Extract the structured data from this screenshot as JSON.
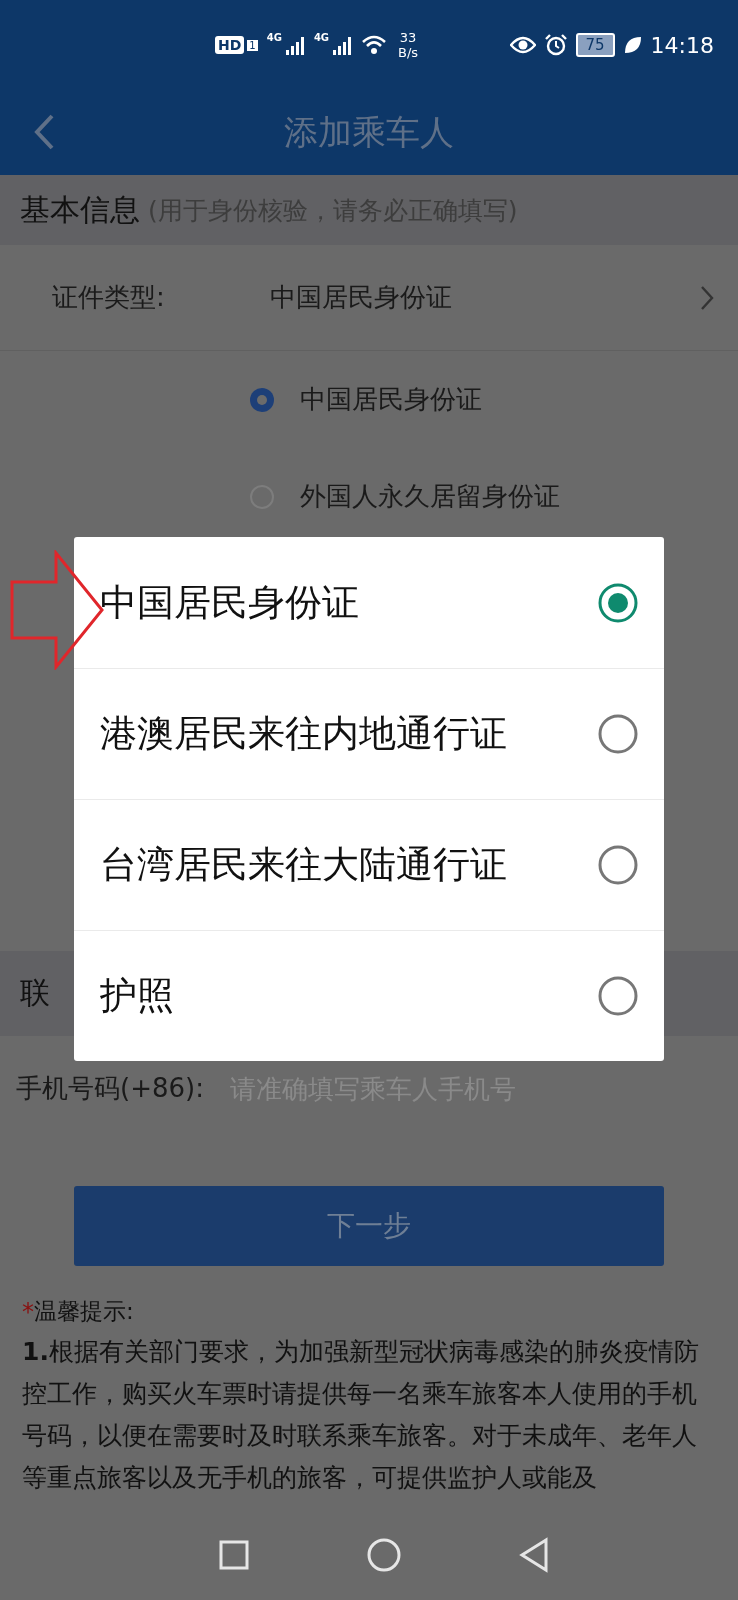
{
  "status_bar": {
    "hd": "HD",
    "sim": "1",
    "signal_labels": [
      "4G",
      "4G"
    ],
    "net_speed": "33",
    "net_unit": "B/s",
    "battery": "75",
    "time": "14:18"
  },
  "header": {
    "title": "添加乘车人"
  },
  "basic_section": {
    "title": "基本信息",
    "note": "(用于身份核验，请务必正确填写)"
  },
  "id_type_row": {
    "label": "证件类型:",
    "value": "中国居民身份证"
  },
  "id_radios": [
    {
      "label": "中国居民身份证",
      "selected": true
    },
    {
      "label": "外国人永久居留身份证",
      "selected": false
    }
  ],
  "contact_section": {
    "title": "联"
  },
  "phone_row": {
    "label": "手机号码(+86):",
    "placeholder": "请准确填写乘车人手机号"
  },
  "next_button": "下一步",
  "notice": {
    "mark": "*",
    "title": "温馨提示:",
    "text": "**1.**根据有关部门要求，为加强新型冠状病毒感染的肺炎疫情防控工作，购买火车票时请提供每一名乘车旅客本人使用的手机号码，以便在需要时及时联系乘车旅客。对于未成年、老年人等重点旅客以及无手机的旅客，可提供监护人或能及"
  },
  "dialog": {
    "options": [
      {
        "label": "中国居民身份证",
        "selected": true
      },
      {
        "label": "港澳居民来往内地通行证",
        "selected": false
      },
      {
        "label": "台湾居民来往大陆通行证",
        "selected": false
      },
      {
        "label": "护照",
        "selected": false
      }
    ]
  }
}
